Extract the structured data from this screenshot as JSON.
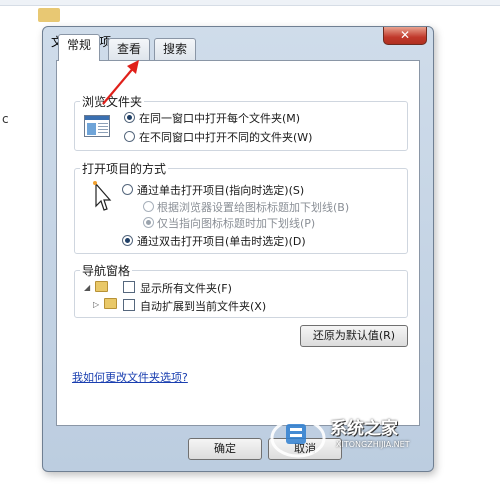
{
  "dialog": {
    "title": "文件夹选项",
    "close_label": "✕"
  },
  "tabs": [
    {
      "label": "常规",
      "active": true
    },
    {
      "label": "查看",
      "active": false
    },
    {
      "label": "搜索",
      "active": false
    }
  ],
  "browse_folders": {
    "title": "浏览文件夹",
    "options": [
      {
        "label": "在同一窗口中打开每个文件夹(M)",
        "checked": true
      },
      {
        "label": "在不同窗口中打开不同的文件夹(W)",
        "checked": false
      }
    ]
  },
  "open_items": {
    "title": "打开项目的方式",
    "options": [
      {
        "label": "通过单击打开项目(指向时选定)(S)",
        "checked": false,
        "disabled": false
      },
      {
        "label": "根据浏览器设置给图标标题加下划线(B)",
        "checked": false,
        "disabled": true
      },
      {
        "label": "仅当指向图标标题时加下划线(P)",
        "checked": true,
        "disabled": true
      },
      {
        "label": "通过双击打开项目(单击时选定)(D)",
        "checked": true,
        "disabled": false
      }
    ]
  },
  "nav_pane": {
    "title": "导航窗格",
    "options": [
      {
        "label": "显示所有文件夹(F)",
        "checked": false
      },
      {
        "label": "自动扩展到当前文件夹(X)",
        "checked": false
      }
    ]
  },
  "restore_defaults_label": "还原为默认值(R)",
  "help_link": "我如何更改文件夹选项?",
  "buttons": {
    "ok": "确定",
    "cancel": "取消"
  },
  "watermark": {
    "name": "系统之家",
    "url": "XITONGZHIJIA.NET"
  },
  "colors": {
    "annotation_arrow": "#e0201a",
    "link": "#1a3fb0"
  }
}
